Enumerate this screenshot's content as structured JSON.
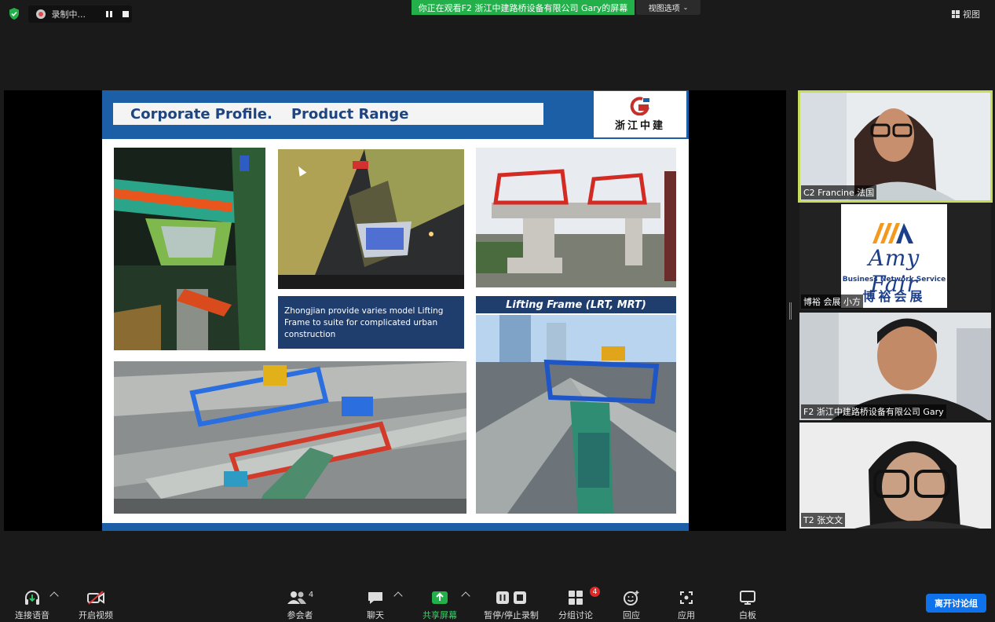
{
  "recording": {
    "label": "录制中..."
  },
  "banner": {
    "text": "你正在观看F2 浙江中建路桥设备有限公司 Gary的屏幕"
  },
  "view_options": {
    "label": "视图选项"
  },
  "view": {
    "label": "视图"
  },
  "slide": {
    "title_part1": "Corporate Profile.",
    "title_part2": "Product Range",
    "logo_text": "浙江中建",
    "caption": "Zhongjian provide varies model Lifting Frame to suite for complicated urban construction",
    "lifting_label": "Lifting Frame (LRT, MRT)"
  },
  "participants": [
    {
      "name": "C2 Francine 法国",
      "active": true
    },
    {
      "name": "博裕 会展 小方",
      "logo": {
        "title": "Amy  Fair",
        "subtitle": "Business Network Service",
        "cn": "博裕会展"
      }
    },
    {
      "name": "F2 浙江中建路桥设备有限公司 Gary"
    },
    {
      "name": "T2 张文文"
    }
  ],
  "toolbar": {
    "audio": "连接语音",
    "video": "开启视频",
    "participants": "参会者",
    "participants_count": "4",
    "chat": "聊天",
    "share": "共享屏幕",
    "record": "暂停/停止录制",
    "breakout": "分组讨论",
    "breakout_badge": "4",
    "reactions": "回应",
    "apps": "应用",
    "whiteboard": "白板",
    "leave": "离开讨论组"
  },
  "colors": {
    "share_green": "#23b04b",
    "leave_blue": "#0e72ed",
    "slide_blue": "#1d5fa6",
    "active_outline": "#c7dc5a"
  }
}
